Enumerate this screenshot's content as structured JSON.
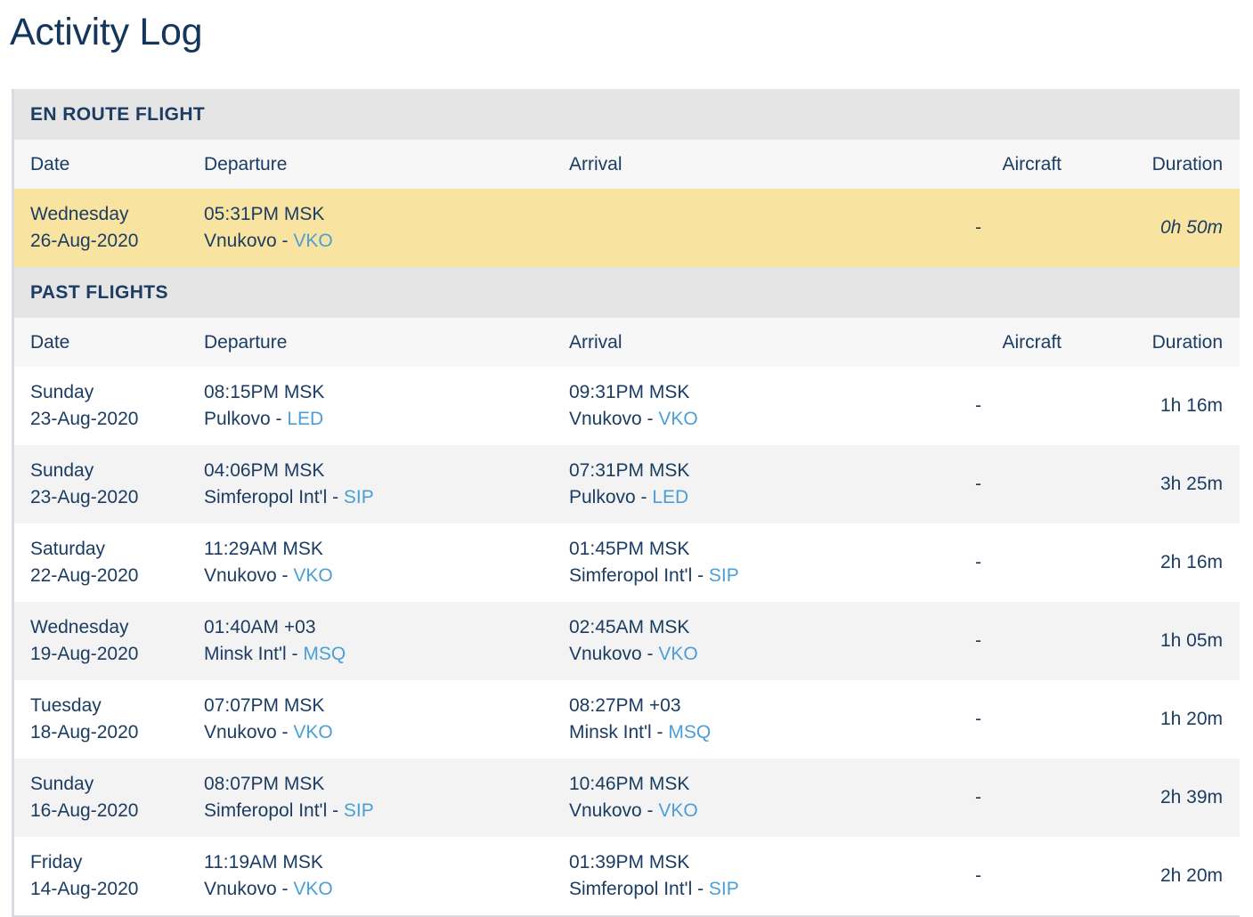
{
  "page": {
    "title": "Activity Log"
  },
  "colors": {
    "title": "#15365c",
    "text": "#1b3c63",
    "link": "#4a9fd6",
    "section_header_bg": "#e5e5e5",
    "column_header_bg": "#f7f7f7",
    "row_bg": "#ffffff",
    "row_alt_bg": "#f3f3f3",
    "enroute_row_bg": "#f8e4a0",
    "panel_border": "#d8dde3"
  },
  "columns": {
    "date": "Date",
    "departure": "Departure",
    "arrival": "Arrival",
    "aircraft": "Aircraft",
    "duration": "Duration"
  },
  "sections": [
    {
      "id": "en-route-flight",
      "label": "EN ROUTE FLIGHT",
      "rows": [
        {
          "day": "Wednesday",
          "date": "26-Aug-2020",
          "dep_time": "05:31PM MSK",
          "dep_airport": "Vnukovo - ",
          "dep_code": "VKO",
          "arr_time": "",
          "arr_airport": "",
          "arr_code": "",
          "aircraft": "-",
          "duration": "0h 50m"
        }
      ]
    },
    {
      "id": "past-flights",
      "label": "PAST FLIGHTS",
      "rows": [
        {
          "day": "Sunday",
          "date": "23-Aug-2020",
          "dep_time": "08:15PM MSK",
          "dep_airport": "Pulkovo - ",
          "dep_code": "LED",
          "arr_time": "09:31PM MSK",
          "arr_airport": "Vnukovo - ",
          "arr_code": "VKO",
          "aircraft": "-",
          "duration": "1h 16m"
        },
        {
          "day": "Sunday",
          "date": "23-Aug-2020",
          "dep_time": "04:06PM MSK",
          "dep_airport": "Simferopol Int'l - ",
          "dep_code": "SIP",
          "arr_time": "07:31PM MSK",
          "arr_airport": "Pulkovo - ",
          "arr_code": "LED",
          "aircraft": "-",
          "duration": "3h 25m"
        },
        {
          "day": "Saturday",
          "date": "22-Aug-2020",
          "dep_time": "11:29AM MSK",
          "dep_airport": "Vnukovo - ",
          "dep_code": "VKO",
          "arr_time": "01:45PM MSK",
          "arr_airport": "Simferopol Int'l - ",
          "arr_code": "SIP",
          "aircraft": "-",
          "duration": "2h 16m"
        },
        {
          "day": "Wednesday",
          "date": "19-Aug-2020",
          "dep_time": "01:40AM +03",
          "dep_airport": "Minsk Int'l - ",
          "dep_code": "MSQ",
          "arr_time": "02:45AM MSK",
          "arr_airport": "Vnukovo - ",
          "arr_code": "VKO",
          "aircraft": "-",
          "duration": "1h 05m"
        },
        {
          "day": "Tuesday",
          "date": "18-Aug-2020",
          "dep_time": "07:07PM MSK",
          "dep_airport": "Vnukovo - ",
          "dep_code": "VKO",
          "arr_time": "08:27PM +03",
          "arr_airport": "Minsk Int'l - ",
          "arr_code": "MSQ",
          "aircraft": "-",
          "duration": "1h 20m"
        },
        {
          "day": "Sunday",
          "date": "16-Aug-2020",
          "dep_time": "08:07PM MSK",
          "dep_airport": "Simferopol Int'l - ",
          "dep_code": "SIP",
          "arr_time": "10:46PM MSK",
          "arr_airport": "Vnukovo - ",
          "arr_code": "VKO",
          "aircraft": "-",
          "duration": "2h 39m"
        },
        {
          "day": "Friday",
          "date": "14-Aug-2020",
          "dep_time": "11:19AM MSK",
          "dep_airport": "Vnukovo - ",
          "dep_code": "VKO",
          "arr_time": "01:39PM MSK",
          "arr_airport": "Simferopol Int'l - ",
          "arr_code": "SIP",
          "aircraft": "-",
          "duration": "2h 20m"
        }
      ]
    }
  ]
}
